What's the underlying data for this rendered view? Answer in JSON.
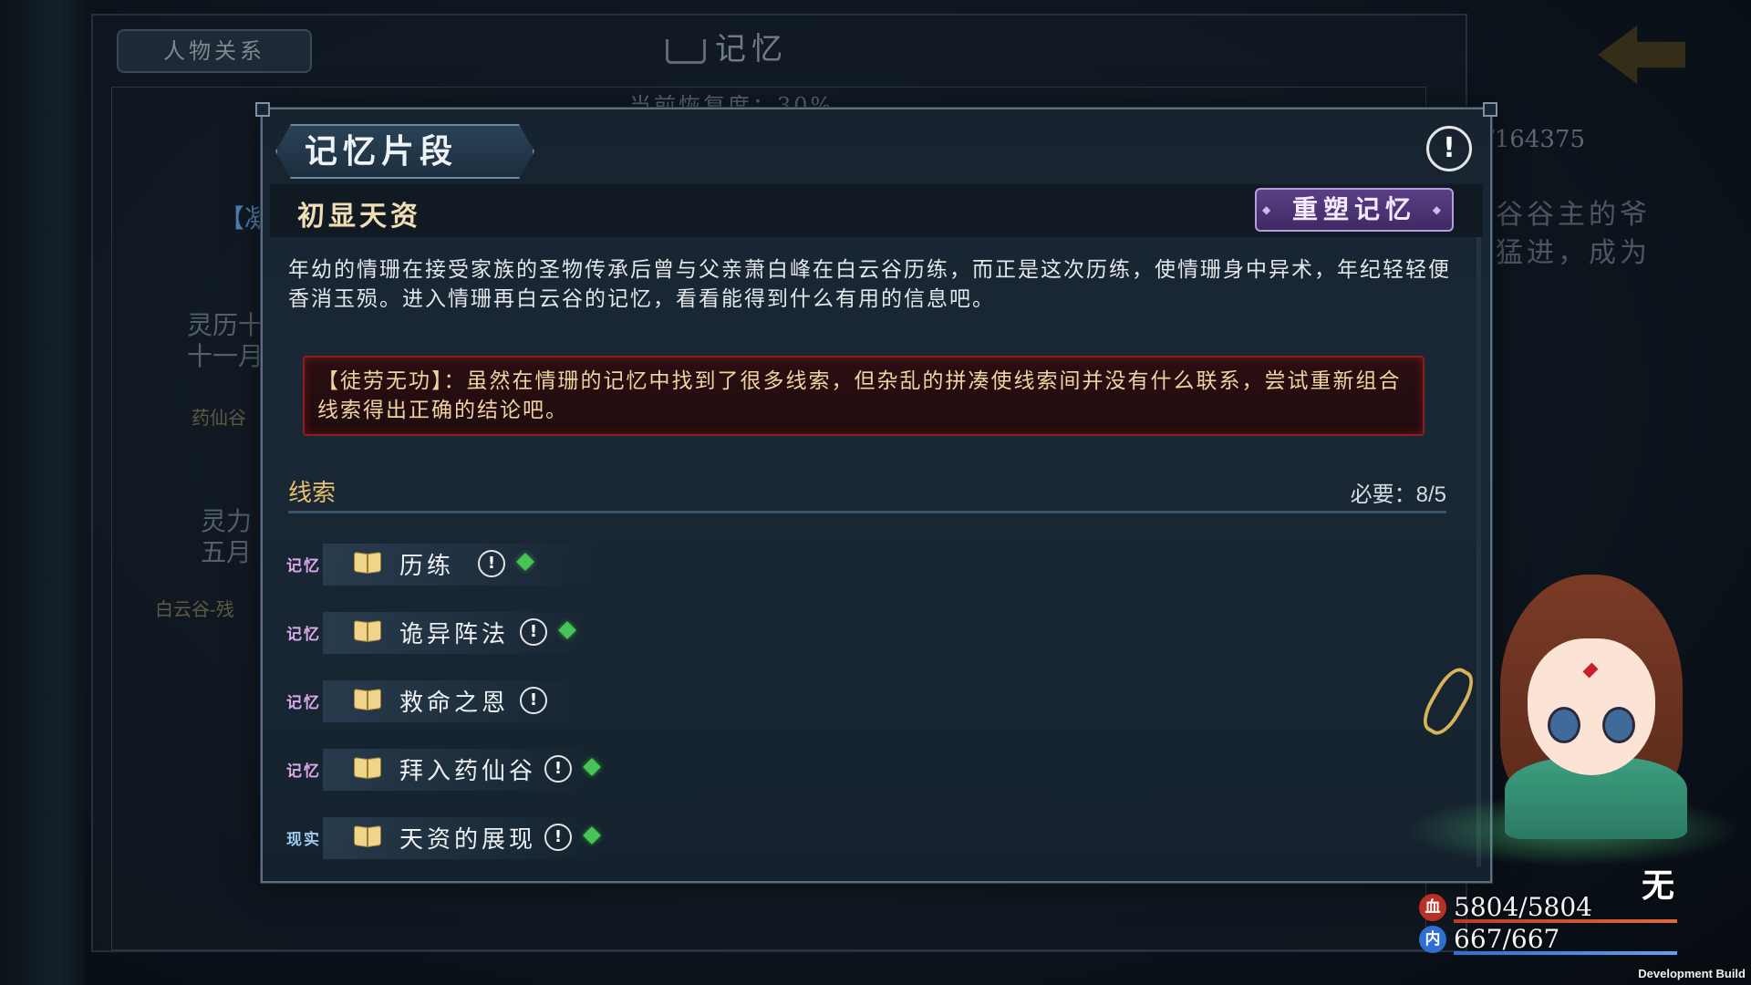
{
  "background": {
    "tab_label": "人物关系",
    "title": "记忆",
    "progress_text": "当前恢复度：30%",
    "right_counter": "/164375",
    "right_text": [
      "谷谷主的爷",
      "猛进，成为"
    ],
    "left_badge": "【凝",
    "left_entry1": [
      "灵历十",
      "十一月"
    ],
    "left_place1": "药仙谷",
    "left_entry2": [
      "灵力",
      "五月"
    ],
    "left_place2": "白云谷-残"
  },
  "dialog": {
    "header": "记忆片段",
    "info_symbol": "!",
    "memory_title": "初显天资",
    "reshape_button": "重塑记忆",
    "description": "年幼的情珊在接受家族的圣物传承后曾与父亲萧白峰在白云谷历练，而正是这次历练，使情珊身中异术，年纪轻轻便香消玉殒。进入情珊再白云谷的记忆，看看能得到什么有用的信息吧。",
    "warning": "【徒劳无功】：虽然在情珊的记忆中找到了很多线索，但杂乱的拼凑使线索间并没有什么联系，尝试重新组合线索得出正确的结论吧。",
    "clues_label": "线索",
    "required": "必要：8/5",
    "clues": [
      {
        "tag": "记忆",
        "name": "历练",
        "has_gem": true
      },
      {
        "tag": "记忆",
        "name": "诡异阵法",
        "has_gem": true
      },
      {
        "tag": "记忆",
        "name": "救命之恩",
        "has_gem": false
      },
      {
        "tag": "记忆",
        "name": "拜入药仙谷",
        "has_gem": true
      },
      {
        "tag": "现实",
        "name": "天资的展现",
        "has_gem": true
      }
    ]
  },
  "character": {
    "name_glyph": "无",
    "hp_icon": "血",
    "hp": "5804/5804",
    "mp_icon": "内",
    "mp": "667/667",
    "hp_color": "#c0392b",
    "mp_color": "#2e6fd1"
  },
  "footer": {
    "build_label": "Development Build"
  }
}
